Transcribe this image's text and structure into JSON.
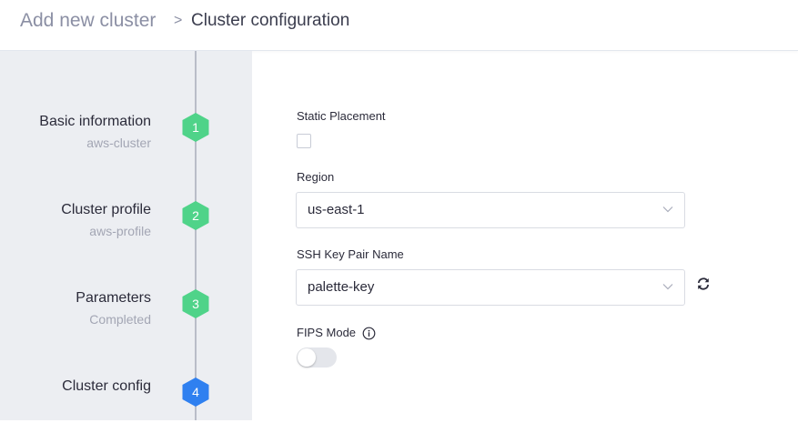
{
  "breadcrumb": {
    "parent": "Add new cluster",
    "separator": ">",
    "current": "Cluster configuration"
  },
  "steps": [
    {
      "title": "Basic information",
      "subtitle": "aws-cluster",
      "number": "1",
      "status": "completed"
    },
    {
      "title": "Cluster profile",
      "subtitle": "aws-profile",
      "number": "2",
      "status": "completed"
    },
    {
      "title": "Parameters",
      "subtitle": "Completed",
      "number": "3",
      "status": "completed"
    },
    {
      "title": "Cluster config",
      "subtitle": "",
      "number": "4",
      "status": "active"
    }
  ],
  "colors": {
    "step_completed": "#4fd389",
    "step_active": "#2f80f0",
    "step_line": "#b9bdc8",
    "sidebar_bg": "#eceef2"
  },
  "form": {
    "static_placement": {
      "label": "Static Placement",
      "checked": false
    },
    "region": {
      "label": "Region",
      "value": "us-east-1"
    },
    "ssh_key": {
      "label": "SSH Key Pair Name",
      "value": "palette-key"
    },
    "fips": {
      "label": "FIPS Mode",
      "enabled": false
    }
  },
  "icons": {
    "dropdown": "chevron-down-icon",
    "refresh": "refresh-icon",
    "info": "info-icon"
  }
}
